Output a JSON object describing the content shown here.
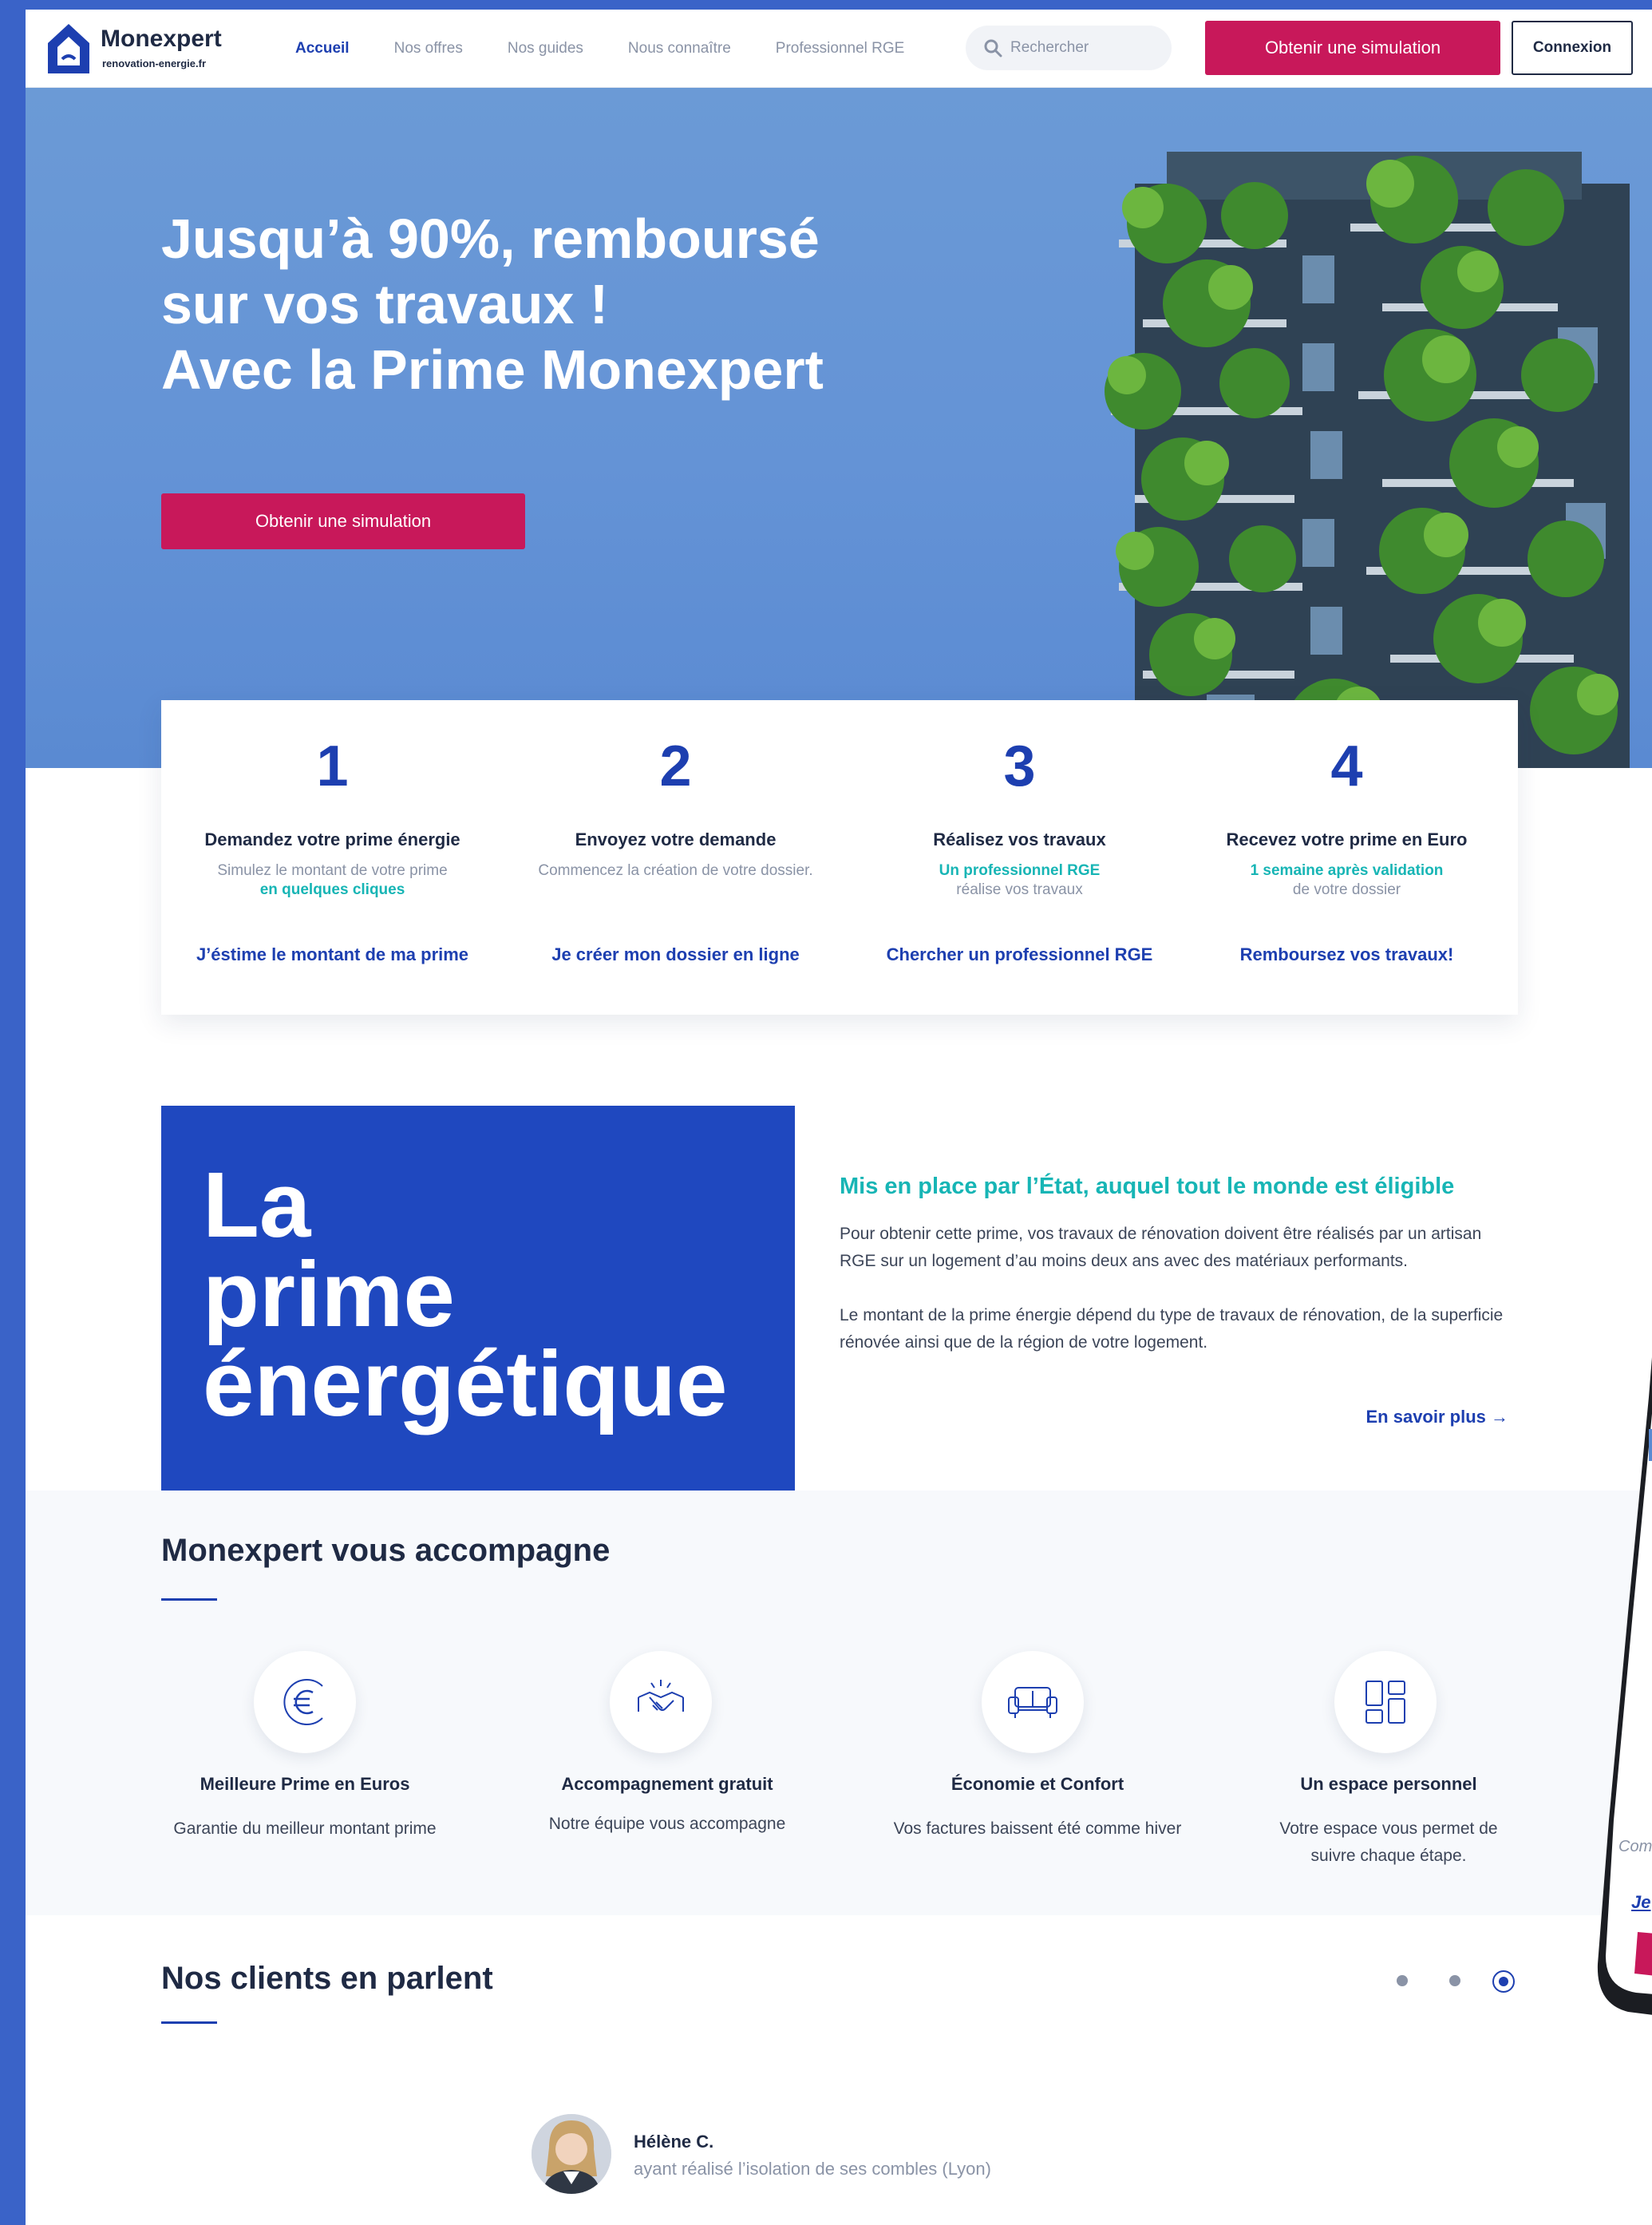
{
  "brand": {
    "name": "Monexpert",
    "domain": "renovation-energie.fr"
  },
  "nav": {
    "items": [
      {
        "label": "Accueil",
        "active": true
      },
      {
        "label": "Nos offres",
        "active": false
      },
      {
        "label": "Nos guides",
        "active": false
      },
      {
        "label": "Nous connaître",
        "active": false
      },
      {
        "label": "Professionnel RGE",
        "active": false
      }
    ],
    "search_placeholder": "Rechercher",
    "cta_label": "Obtenir une simulation",
    "login_label": "Connexion"
  },
  "hero": {
    "title_lines": [
      "Jusqu’à 90%, remboursé",
      "sur vos travaux !",
      "Avec la Prime Monexpert"
    ],
    "cta_label": "Obtenir une simulation"
  },
  "steps": [
    {
      "number": "1",
      "title": "Demandez  votre prime énergie",
      "desc": "Simulez le montant de votre prime",
      "highlight": "en quelques cliques",
      "highlight_first": false,
      "link": "J’éstime le montant de ma prime"
    },
    {
      "number": "2",
      "title": "Envoyez votre demande",
      "desc": "Commencez la création de votre dossier.",
      "highlight": "",
      "highlight_first": false,
      "link": "Je créer mon dossier en ligne"
    },
    {
      "number": "3",
      "title": "Réalisez vos travaux",
      "desc": "réalise vos travaux",
      "highlight": "Un professionnel RGE",
      "highlight_first": true,
      "link": "Chercher un professionnel RGE"
    },
    {
      "number": "4",
      "title": "Recevez votre prime en Euro",
      "desc": "de votre dossier",
      "highlight": "1 semaine après validation",
      "highlight_first": true,
      "link": "Remboursez vos travaux!"
    }
  ],
  "prime": {
    "title_lines": [
      "La",
      "prime",
      "énergétique"
    ],
    "subtitle": "Mis en place par l’État, auquel tout le monde est éligible",
    "paragraph1": "Pour obtenir cette prime, vos travaux de rénovation doivent être réalisés par un artisan RGE sur un logement d’au moins deux ans avec des matériaux performants.",
    "paragraph2": "Le montant de la prime énergie dépend du type de travaux de rénovation, de la superficie rénovée ainsi que de la région de votre logement.",
    "link": "En savoir plus →"
  },
  "accompagne": {
    "title": "Monexpert vous accompagne",
    "features": [
      {
        "icon": "euro-icon",
        "title": "Meilleure Prime en Euros",
        "desc": "Garantie du meilleur montant prime"
      },
      {
        "icon": "handshake-icon",
        "title": "Accompagnement gratuit",
        "desc": "Notre équipe vous accompagne"
      },
      {
        "icon": "sofa-icon",
        "title": "Économie et Confort",
        "desc": "Vos factures baissent été comme hiver"
      },
      {
        "icon": "dashboard-icon",
        "title": "Un espace personnel",
        "desc": "Votre espace vous permet de suivre chaque étape."
      }
    ]
  },
  "clients": {
    "title": "Nos clients en parlent",
    "carousel_total": 3,
    "carousel_active": 3,
    "testimonial": {
      "name": "Hélène C.",
      "desc": "ayant réalisé l’isolation de ses combles (Lyon)"
    }
  },
  "phone": {
    "text1": "Com",
    "text2": "Je"
  },
  "colors": {
    "primary": "#1d3fb0",
    "accent": "#c8185a",
    "teal": "#17b5b5",
    "hero_bg": "#6493d6"
  }
}
